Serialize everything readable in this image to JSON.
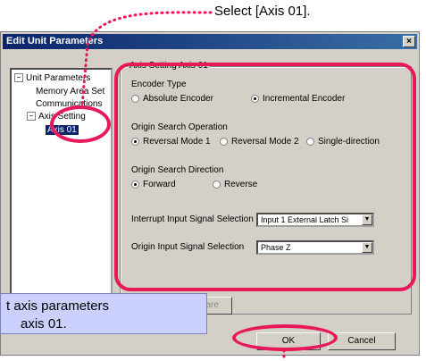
{
  "callout_top": "Select [Axis 01].",
  "window": {
    "title": "Edit Unit Parameters",
    "close_glyph": "×"
  },
  "tree": {
    "root": "Unit Parameters",
    "memory": "Memory Area Set",
    "communications": "Communications",
    "axis_settings": "Axis Setting",
    "axis01": "Axis 01",
    "expander_minus": "−"
  },
  "group": {
    "title": "Axis Setting Axis 01",
    "encoder_type_label": "Encoder Type",
    "encoder_abs": "Absolute Encoder",
    "encoder_inc": "Incremental Encoder",
    "origin_search_op_label": "Origin Search Operation",
    "rev_mode1": "Reversal Mode 1",
    "rev_mode2": "Reversal Mode 2",
    "single_dir": "Single-direction",
    "origin_search_dir_label": "Origin Search Direction",
    "forward": "Forward",
    "reverse": "Reverse",
    "interrupt_label": "Interrupt Input Signal Selection",
    "interrupt_value": "Input 1 External  Latch Si",
    "origin_input_label": "Origin Input Signal Selection",
    "origin_input_value": "Phase Z"
  },
  "buttons": {
    "compare": "ompare",
    "ok": "OK",
    "cancel": "Cancel"
  },
  "note": {
    "line1": "t axis parameters",
    "line2": "axis 01."
  },
  "colors": {
    "highlight": "#e8195a",
    "note_bg": "#ccd0ff",
    "titlebar": "#0a246a"
  }
}
